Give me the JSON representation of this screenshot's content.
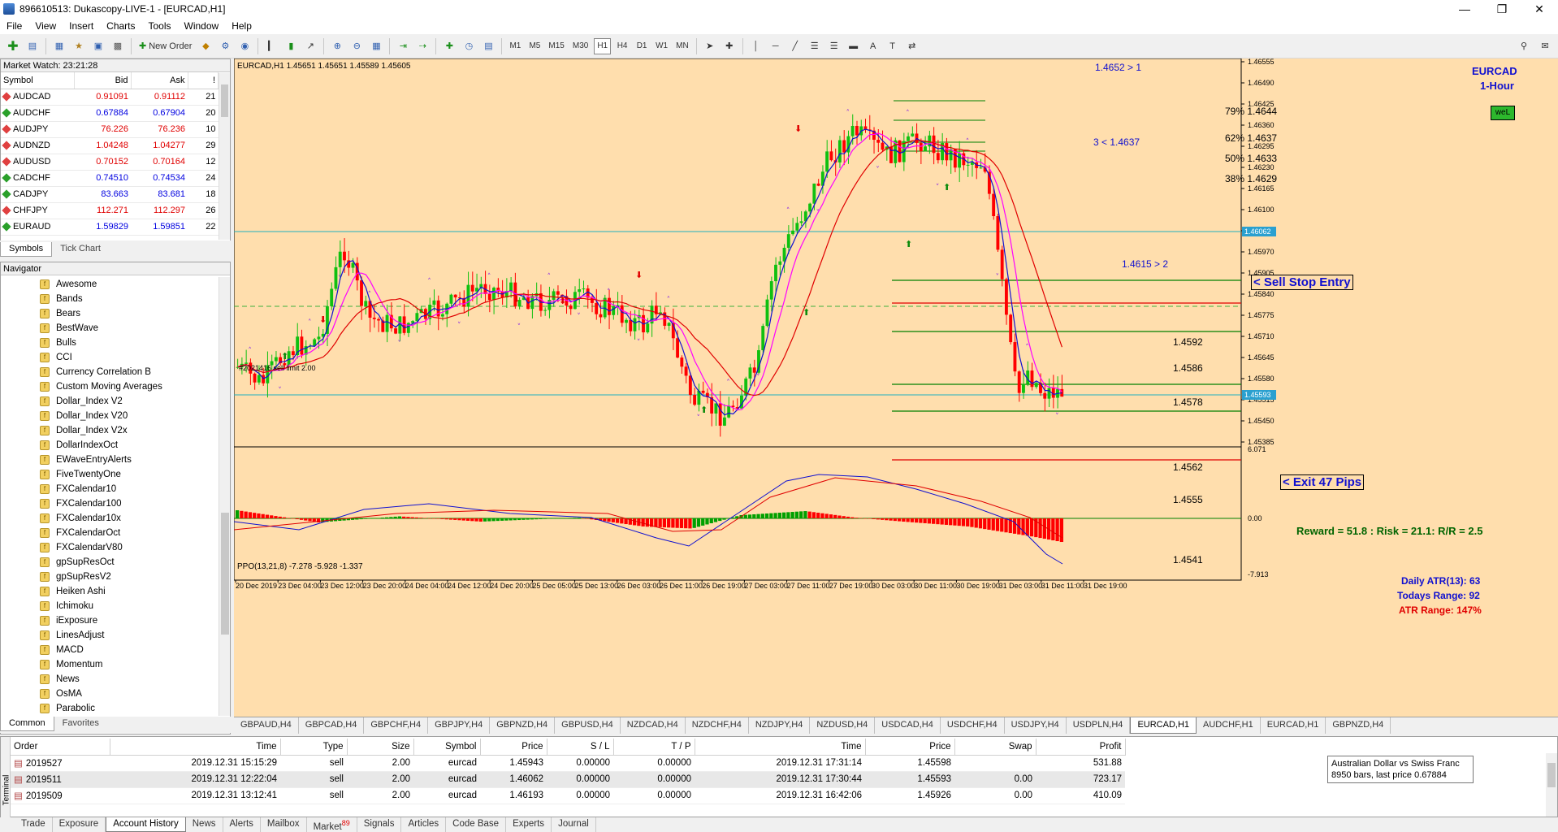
{
  "title": "896610513: Dukascopy-LIVE-1 - [EURCAD,H1]",
  "menu": [
    "File",
    "View",
    "Insert",
    "Charts",
    "Tools",
    "Window",
    "Help"
  ],
  "toolbar": {
    "new_order": "New Order",
    "timeframes": [
      "M1",
      "M5",
      "M15",
      "M30",
      "H1",
      "H4",
      "D1",
      "W1",
      "MN"
    ],
    "active_tf": "H1"
  },
  "market_watch": {
    "header": "Market Watch: 23:21:28",
    "cols": [
      "Symbol",
      "Bid",
      "Ask",
      "!"
    ],
    "rows": [
      {
        "s": "AUDCAD",
        "b": "0.91091",
        "a": "0.91112",
        "sp": "21",
        "c": "red"
      },
      {
        "s": "AUDCHF",
        "b": "0.67884",
        "a": "0.67904",
        "sp": "20",
        "c": "blue"
      },
      {
        "s": "AUDJPY",
        "b": "76.226",
        "a": "76.236",
        "sp": "10",
        "c": "red"
      },
      {
        "s": "AUDNZD",
        "b": "1.04248",
        "a": "1.04277",
        "sp": "29",
        "c": "red"
      },
      {
        "s": "AUDUSD",
        "b": "0.70152",
        "a": "0.70164",
        "sp": "12",
        "c": "red"
      },
      {
        "s": "CADCHF",
        "b": "0.74510",
        "a": "0.74534",
        "sp": "24",
        "c": "blue"
      },
      {
        "s": "CADJPY",
        "b": "83.663",
        "a": "83.681",
        "sp": "18",
        "c": "blue"
      },
      {
        "s": "CHFJPY",
        "b": "112.271",
        "a": "112.297",
        "sp": "26",
        "c": "red"
      },
      {
        "s": "EURAUD",
        "b": "1.59829",
        "a": "1.59851",
        "sp": "22",
        "c": "blue"
      }
    ],
    "tabs": [
      "Symbols",
      "Tick Chart"
    ]
  },
  "navigator": {
    "header": "Navigator",
    "items": [
      "Awesome",
      "Bands",
      "Bears",
      "BestWave",
      "Bulls",
      "CCI",
      "Currency Correlation B",
      "Custom Moving Averages",
      "Dollar_Index V2",
      "Dollar_Index V20",
      "Dollar_Index V2x",
      "DollarIndexOct",
      "EWaveEntryAlerts",
      "FiveTwentyOne",
      "FXCalendar10",
      "FXCalendar100",
      "FXCalendar10x",
      "FXCalendarOct",
      "FXCalendarV80",
      "gpSupResOct",
      "gpSupResV2",
      "Heiken Ashi",
      "Ichimoku",
      "iExposure",
      "LinesAdjust",
      "MACD",
      "Momentum",
      "News",
      "OsMA",
      "Parabolic"
    ],
    "tabs": [
      "Common",
      "Favorites"
    ]
  },
  "chart": {
    "info": "EURCAD,H1  1.45651 1.45651 1.45589 1.45605",
    "symbol": "EURCAD",
    "period": "1-Hour",
    "badge": "weL",
    "order_label": "#2021416 sell limit 2.00",
    "fib_top": "1.4652 > 1",
    "fib_bottom": "1.4615 > 2",
    "fib_mid": "3 < 1.4637",
    "fib": [
      {
        "t": "79% 1.4644"
      },
      {
        "t": "62% 1.4637"
      },
      {
        "t": "50% 1.4633"
      },
      {
        "t": "38% 1.4629"
      }
    ],
    "levels": [
      {
        "t": "1.4592",
        "c": "#008000"
      },
      {
        "t": "1.4586",
        "c": "#e00000"
      },
      {
        "t": "1.4578",
        "c": "#008000"
      },
      {
        "t": "1.4562",
        "c": "#008000"
      },
      {
        "t": "1.4555",
        "c": "#008000"
      },
      {
        "t": "1.4541",
        "c": "#e00000"
      }
    ],
    "sell_stop": "< Sell Stop Entry",
    "exit": "< Exit 47 Pips",
    "reward": "Reward = 51.8 : Risk = 21.1: R/R = 2.5",
    "price_axis": [
      "1.46555",
      "1.46490",
      "1.46425",
      "1.46360",
      "1.46295",
      "1.46230",
      "1.46165",
      "1.46100",
      "1.46035",
      "1.45970",
      "1.45905",
      "1.45840",
      "1.45775",
      "1.45710",
      "1.45645",
      "1.45580",
      "1.45515",
      "1.45450",
      "1.45385"
    ],
    "price_tag_top": "1.46062",
    "price_tag_bottom": "1.45593",
    "ppo": {
      "label": "PPO(13,21,8) -7.278 -5.928 -1.337",
      "axis": [
        "6.071",
        "0.00",
        "-7.913"
      ],
      "atr": "Daily ATR(13): 63",
      "range": "Todays Range: 92",
      "atr_range": "ATR Range: 147%"
    },
    "time_axis": [
      "20 Dec 2019",
      "23 Dec 04:00",
      "23 Dec 12:00",
      "23 Dec 20:00",
      "24 Dec 04:00",
      "24 Dec 12:00",
      "24 Dec 20:00",
      "25 Dec 05:00",
      "25 Dec 13:00",
      "26 Dec 03:00",
      "26 Dec 11:00",
      "26 Dec 19:00",
      "27 Dec 03:00",
      "27 Dec 11:00",
      "27 Dec 19:00",
      "30 Dec 03:00",
      "30 Dec 11:00",
      "30 Dec 19:00",
      "31 Dec 03:00",
      "31 Dec 11:00",
      "31 Dec 19:00"
    ]
  },
  "symbol_tabs": [
    "GBPAUD,H4",
    "GBPCAD,H4",
    "GBPCHF,H4",
    "GBPJPY,H4",
    "GBPNZD,H4",
    "GBPUSD,H4",
    "NZDCAD,H4",
    "NZDCHF,H4",
    "NZDJPY,H4",
    "NZDUSD,H4",
    "USDCAD,H4",
    "USDCHF,H4",
    "USDJPY,H4",
    "USDPLN,H4",
    "EURCAD,H1",
    "AUDCHF,H1",
    "EURCAD,H1",
    "GBPNZD,H4"
  ],
  "active_symbol_tab": "EURCAD,H1",
  "terminal": {
    "cols": [
      "Order",
      "Time",
      "Type",
      "Size",
      "Symbol",
      "Price",
      "S / L",
      "T / P",
      "Time",
      "Price",
      "Swap",
      "Profit"
    ],
    "rows": [
      {
        "o": "2019527",
        "t": "2019.12.31 15:15:29",
        "ty": "sell",
        "sz": "2.00",
        "sy": "eurcad",
        "p": "1.45943",
        "sl": "0.00000",
        "tp": "0.00000",
        "t2": "2019.12.31 17:31:14",
        "p2": "1.45598",
        "sw": "",
        "pr": "531.88"
      },
      {
        "o": "2019511",
        "t": "2019.12.31 12:22:04",
        "ty": "sell",
        "sz": "2.00",
        "sy": "eurcad",
        "p": "1.46062",
        "sl": "0.00000",
        "tp": "0.00000",
        "t2": "2019.12.31 17:30:44",
        "p2": "1.45593",
        "sw": "0.00",
        "pr": "723.17"
      },
      {
        "o": "2019509",
        "t": "2019.12.31 13:12:41",
        "ty": "sell",
        "sz": "2.00",
        "sy": "eurcad",
        "p": "1.46193",
        "sl": "0.00000",
        "tp": "0.00000",
        "t2": "2019.12.31 16:42:06",
        "p2": "1.45926",
        "sw": "0.00",
        "pr": "410.09"
      }
    ],
    "tooltip_l1": "Australian Dollar vs Swiss Franc",
    "tooltip_l2": "8950 bars, last price 0.67884"
  },
  "bottom_tabs": [
    "Trade",
    "Exposure",
    "Account History",
    "News",
    "Alerts",
    "Mailbox",
    "Market",
    "Signals",
    "Articles",
    "Code Base",
    "Experts",
    "Journal"
  ],
  "active_bottom": "Account History",
  "market_badge": "89",
  "terminal_side": "Terminal"
}
